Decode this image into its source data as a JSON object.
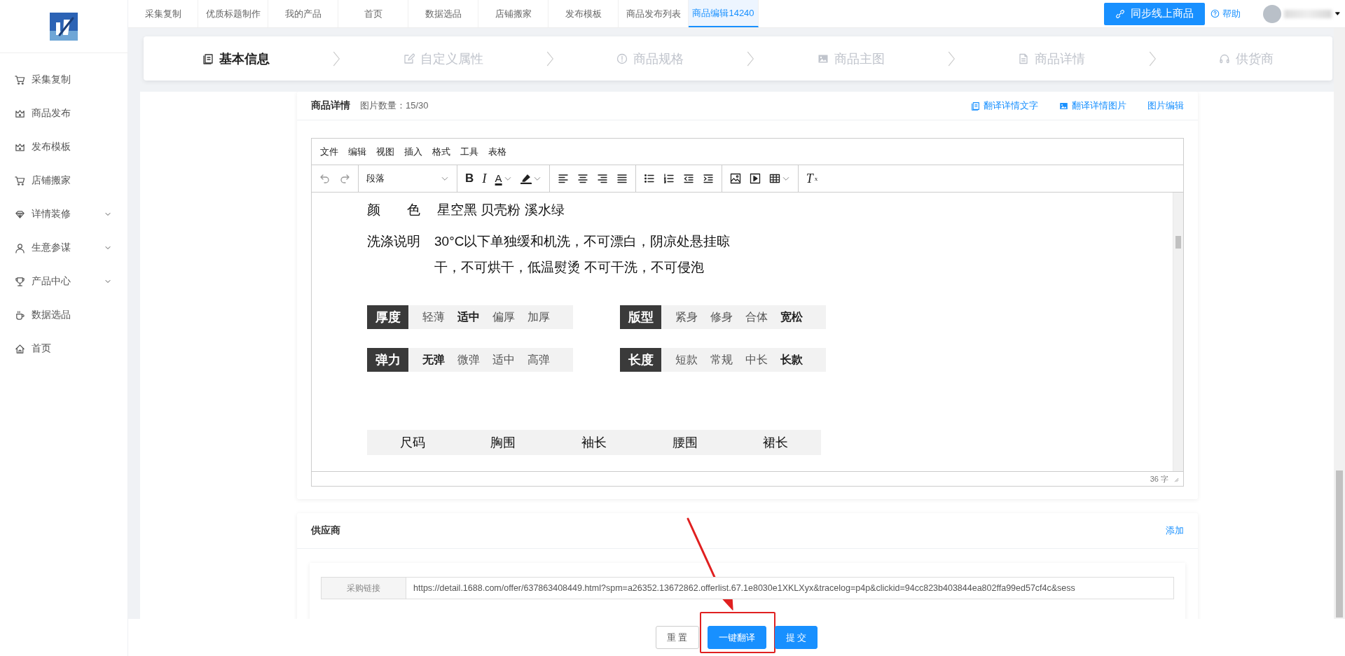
{
  "nav_tabs": [
    {
      "label": "采集复制",
      "selected": false
    },
    {
      "label": "优质标题制作",
      "selected": false
    },
    {
      "label": "我的产品",
      "selected": false
    },
    {
      "label": "首页",
      "selected": false
    },
    {
      "label": "数据选品",
      "selected": false
    },
    {
      "label": "店铺搬家",
      "selected": false
    },
    {
      "label": "发布模板",
      "selected": false
    },
    {
      "label": "商品发布列表",
      "selected": false
    },
    {
      "label": "商品编辑14240",
      "selected": true
    }
  ],
  "sync_button": "同步线上商品",
  "help_link": "帮助",
  "sidebar": {
    "items": [
      {
        "label": "采集复制",
        "kind": "link"
      },
      {
        "label": "商品发布",
        "kind": "link"
      },
      {
        "label": "发布模板",
        "kind": "link"
      },
      {
        "label": "店铺搬家",
        "kind": "link"
      },
      {
        "label": "详情装修",
        "kind": "group"
      },
      {
        "label": "生意参谋",
        "kind": "group"
      },
      {
        "label": "产品中心",
        "kind": "group"
      },
      {
        "label": "数据选品",
        "kind": "link"
      },
      {
        "label": "首页",
        "kind": "link"
      }
    ]
  },
  "steps": [
    {
      "label": "基本信息",
      "selected": true
    },
    {
      "label": "自定义属性",
      "selected": false
    },
    {
      "label": "商品规格",
      "selected": false
    },
    {
      "label": "商品主图",
      "selected": false
    },
    {
      "label": "商品详情",
      "selected": false
    },
    {
      "label": "供货商",
      "selected": false
    }
  ],
  "detail_card": {
    "title": "商品详情",
    "image_count": "图片数量：15/30",
    "actions": [
      "翻译详情文字",
      "翻译详情图片",
      "图片编辑"
    ]
  },
  "editor": {
    "menu": [
      "文件",
      "编辑",
      "视图",
      "插入",
      "格式",
      "工具",
      "表格"
    ],
    "toolbar": [
      [
        {
          "kind": "undo",
          "disabled": true
        },
        {
          "kind": "redo",
          "disabled": true
        }
      ],
      [
        {
          "kind": "format-select",
          "label": "段落",
          "disabled": false
        }
      ],
      [
        {
          "kind": "bold",
          "glyph": "B",
          "disabled": false
        },
        {
          "kind": "italic",
          "glyph": "I",
          "disabled": false
        },
        {
          "kind": "text-color",
          "glyph": "A",
          "disabled": false
        },
        {
          "kind": "highlight",
          "disabled": false
        }
      ],
      [
        {
          "kind": "align-left",
          "disabled": false
        },
        {
          "kind": "align-center",
          "disabled": false
        },
        {
          "kind": "align-right",
          "disabled": false
        },
        {
          "kind": "justify",
          "disabled": false
        }
      ],
      [
        {
          "kind": "bullet-list",
          "disabled": false
        },
        {
          "kind": "number-list",
          "disabled": false
        },
        {
          "kind": "outdent",
          "disabled": false
        },
        {
          "kind": "indent",
          "disabled": false
        }
      ],
      [
        {
          "kind": "image",
          "disabled": false
        },
        {
          "kind": "media",
          "disabled": false
        },
        {
          "kind": "table",
          "disabled": false
        }
      ],
      [
        {
          "kind": "clear-format",
          "glyph": "T",
          "subscript": "x",
          "disabled": false
        }
      ]
    ],
    "content": {
      "spec_rows": [
        {
          "label": "颜色",
          "value": "星空黑 贝壳粉 溪水绿"
        },
        {
          "label": "洗涤说明",
          "value": "30°C以下单独缓和机洗，不可漂白，阴凉处悬挂晾干，不可烘干，低温熨烫 不可干洗，不可侵泡"
        }
      ],
      "attribute_tables": [
        {
          "name": "厚度",
          "options": [
            {
              "label": "轻薄",
              "selected": false
            },
            {
              "label": "适中",
              "selected": true
            },
            {
              "label": "偏厚",
              "selected": false
            },
            {
              "label": "加厚",
              "selected": false
            }
          ]
        },
        {
          "name": "版型",
          "options": [
            {
              "label": "紧身",
              "selected": false
            },
            {
              "label": "修身",
              "selected": false
            },
            {
              "label": "合体",
              "selected": false
            },
            {
              "label": "宽松",
              "selected": true
            }
          ]
        },
        {
          "name": "弹力",
          "options": [
            {
              "label": "无弹",
              "selected": true
            },
            {
              "label": "微弹",
              "selected": false
            },
            {
              "label": "适中",
              "selected": false
            },
            {
              "label": "高弹",
              "selected": false
            }
          ]
        },
        {
          "name": "长度",
          "options": [
            {
              "label": "短款",
              "selected": false
            },
            {
              "label": "常规",
              "selected": false
            },
            {
              "label": "中长",
              "selected": false
            },
            {
              "label": "长款",
              "selected": true
            }
          ]
        }
      ],
      "size_table": {
        "columns": [
          "尺码",
          "胸围",
          "袖长",
          "腰围",
          "裙长"
        ]
      }
    },
    "word_count": "36 字"
  },
  "supplier": {
    "title": "供应商",
    "add_link": "添加",
    "link_label": "采购链接",
    "link_value": "https://detail.1688.com/offer/637863408449.html?spm=a26352.13672862.offerlist.67.1e8030e1XKLXyx&tracelog=p4p&clickid=94cc823b403844ea802ffa99ed57cf4c&sess"
  },
  "footer_buttons": [
    {
      "label": "重 置",
      "kind": "default",
      "highlighted": false
    },
    {
      "label": "一键翻译",
      "kind": "primary",
      "highlighted": true
    },
    {
      "label": "提 交",
      "kind": "primary",
      "highlighted": false
    }
  ]
}
